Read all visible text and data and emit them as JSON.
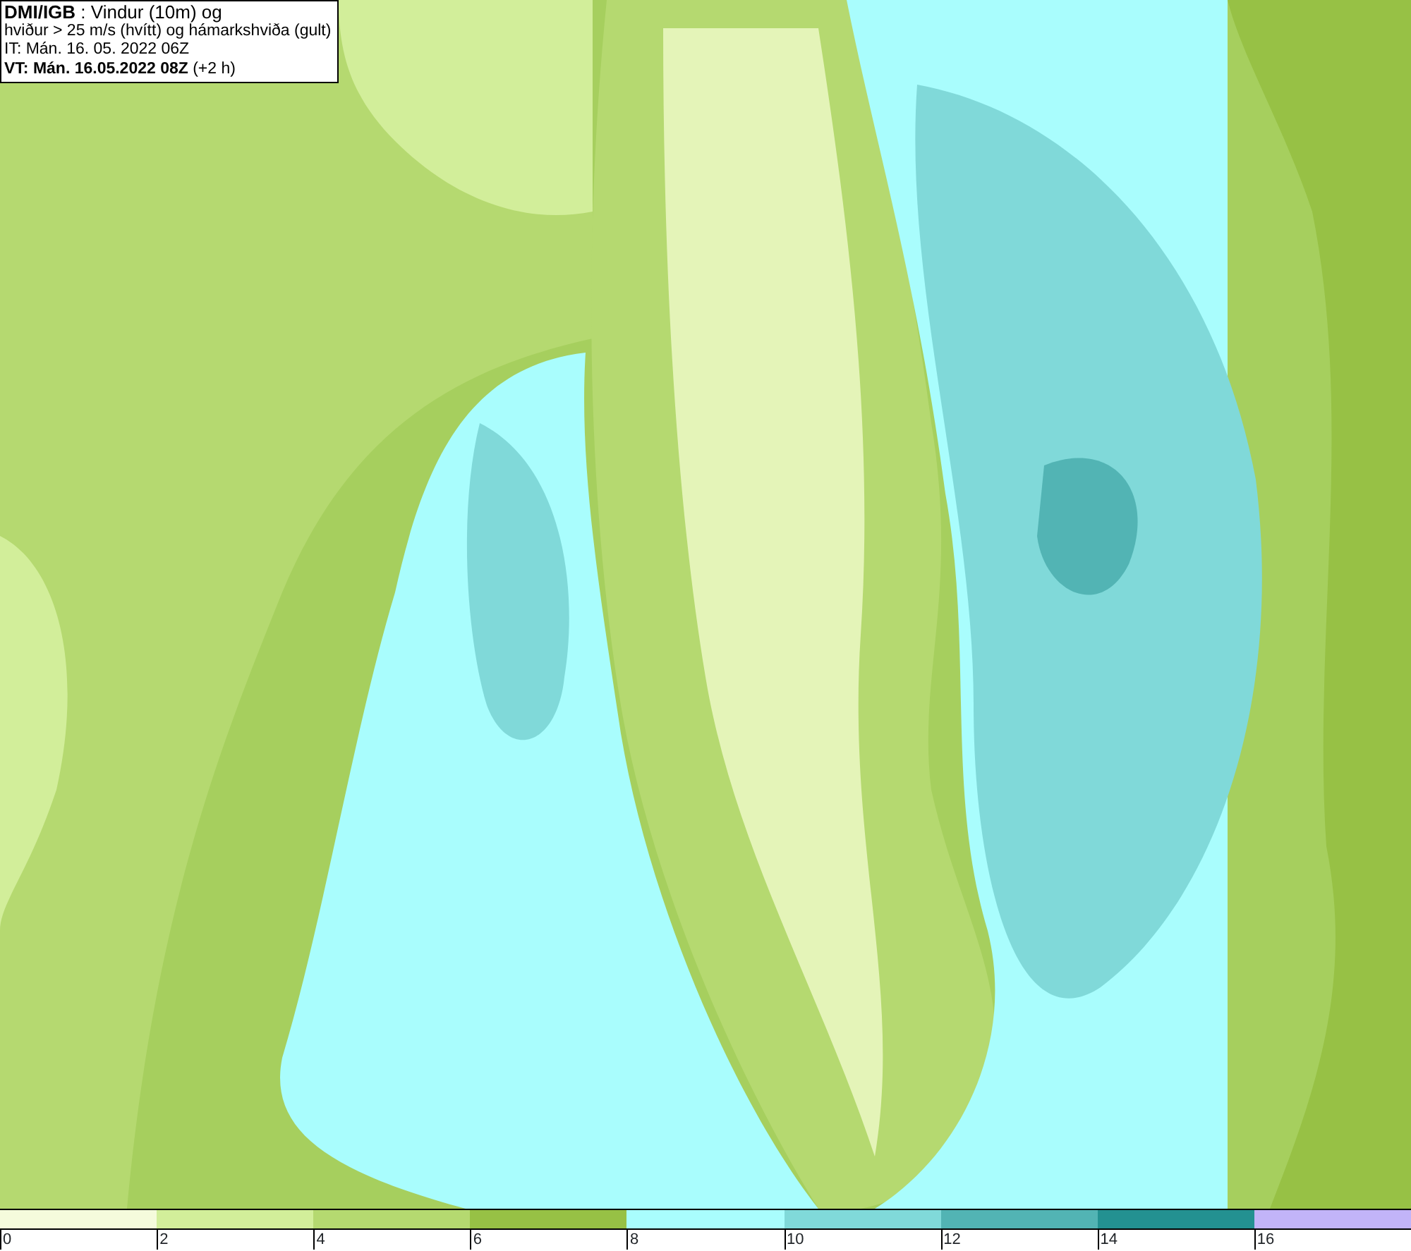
{
  "title_box": {
    "lines": [
      "**DMI/IGB** : Vindur (10m) og",
      "hviður > 25 m/s (hvítt) og hámarkshviða (gult)",
      "IT: Mán. 16. 05. 2022 06Z",
      "**VT: Mán. 16.05.2022 08Z** (+2 h)"
    ]
  },
  "legend": {
    "bins": [
      {
        "color": "#f5fbdc",
        "label": "0"
      },
      {
        "color": "#d2ee9a",
        "label": "2"
      },
      {
        "color": "#b5d970",
        "label": "4"
      },
      {
        "color": "#97c145",
        "label": "6"
      },
      {
        "color": "#a9fdfd",
        "label": "8"
      },
      {
        "color": "#80d9d9",
        "label": "10"
      },
      {
        "color": "#52b4b4",
        "label": "12"
      },
      {
        "color": "#239191",
        "label": "14"
      },
      {
        "color": "#c2b4f8",
        "label": "16"
      }
    ]
  }
}
